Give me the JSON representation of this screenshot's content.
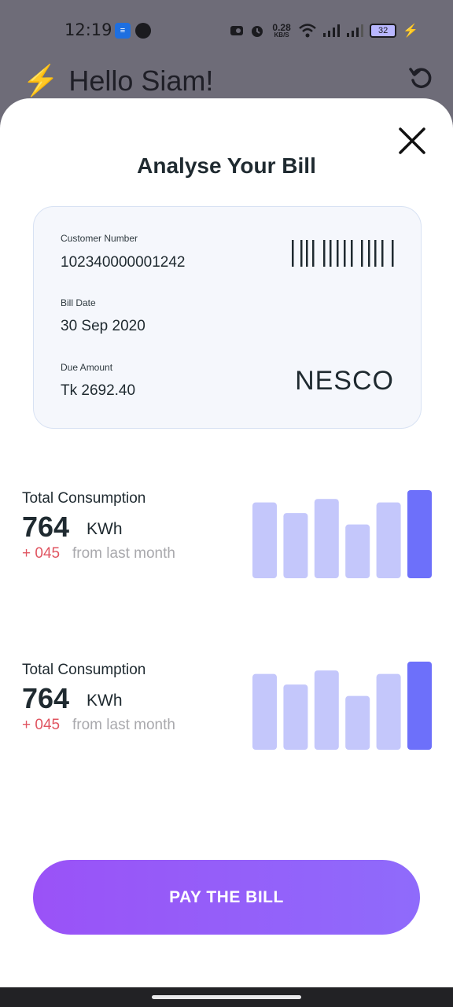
{
  "status_bar": {
    "time": "12:19",
    "net_speed": "0.28",
    "net_unit": "KB/S",
    "battery": "32"
  },
  "header": {
    "greeting": "Hello Siam!"
  },
  "sheet": {
    "title": "Analyse Your Bill",
    "card": {
      "customer_label": "Customer Number",
      "customer_value": "102340000001242",
      "bill_date_label": "Bill Date",
      "bill_date_value": "30 Sep 2020",
      "due_label": "Due Amount",
      "due_value": "Tk 2692.40",
      "provider": "NESCO"
    },
    "consumption": [
      {
        "title": "Total Consumption",
        "value": "764",
        "unit": "KWh",
        "delta": "+ 045",
        "from_text": "from last month",
        "bars": [
          0.86,
          0.74,
          0.9,
          0.61,
          0.86,
          1.0
        ]
      },
      {
        "title": "Total Consumption",
        "value": "764",
        "unit": "KWh",
        "delta": "+ 045",
        "from_text": "from last month",
        "bars": [
          0.86,
          0.74,
          0.9,
          0.61,
          0.86,
          1.0
        ]
      }
    ],
    "pay_button": "PAY THE BILL"
  },
  "colors": {
    "bar_light": "#c4c7fb",
    "bar_accent": "#6d70fa",
    "delta_red": "#e05561",
    "pay_gradient_start": "#9a52f7"
  }
}
